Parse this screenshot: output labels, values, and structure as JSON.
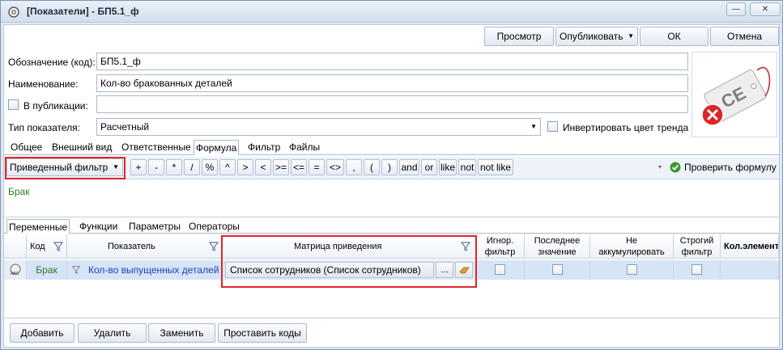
{
  "window": {
    "title": "[Показатели] - БП5.1_ф",
    "minimize": "—",
    "close": "✕"
  },
  "toolbar": {
    "preview": "Просмотр",
    "publish": "Опубликовать",
    "ok": "ОК",
    "cancel": "Отмена"
  },
  "form": {
    "code_label": "Обозначение (код):",
    "code_value": "БП5.1_ф",
    "name_label": "Наименование:",
    "name_value": "Кол-во бракованных деталей",
    "publication_label": "В публикации:",
    "publication_value": "",
    "type_label": "Тип показателя:",
    "type_value": "Расчетный",
    "invert_label": "Инвертировать цвет тренда"
  },
  "tabs": [
    "Общее",
    "Внешний вид",
    "Ответственные",
    "Формула",
    "Фильтр",
    "Файлы"
  ],
  "formula": {
    "filter_mode": "Приведенный фильтр",
    "operators": [
      "+",
      "-",
      "*",
      "/",
      "%",
      "^",
      ">",
      "<",
      ">=",
      "<=",
      "=",
      "<>",
      ",",
      "(",
      ")",
      "and",
      "or",
      "like",
      "not",
      "not like"
    ],
    "check": "Проверить формулу",
    "text": "Брак"
  },
  "subtabs": [
    "Переменные",
    "Функции",
    "Параметры",
    "Операторы"
  ],
  "grid": {
    "columns": {
      "code": "Код",
      "indicator": "Показатель",
      "matrix": "Матрица приведения",
      "ignore_filter_1": "Игнор.",
      "ignore_filter_2": "фильтр",
      "last_value_1": "Последнее",
      "last_value_2": "значение",
      "no_accum_1": "Не",
      "no_accum_2": "аккумулировать",
      "strict_1": "Строгий",
      "strict_2": "фильтр",
      "count": "Кол.элемент"
    },
    "row": {
      "code": "Брак",
      "indicator": "Кол-во выпущенных деталей",
      "matrix": "Список сотрудников (Список сотрудников)",
      "ellipsis": "..."
    }
  },
  "bottom": {
    "add": "Добавить",
    "delete": "Удалить",
    "replace": "Заменить",
    "set_codes": "Проставить коды"
  },
  "icons": {
    "app": "gear-icon",
    "tag": "ce-tag-icon",
    "error": "error-cross-icon",
    "filter": "filter-funnel-icon",
    "check": "check-icon"
  },
  "colors": {
    "formula_text": "#2c7a1f",
    "row_link": "#1a3fb5",
    "highlight": "#e0252b",
    "check": "#3a9a2a"
  }
}
